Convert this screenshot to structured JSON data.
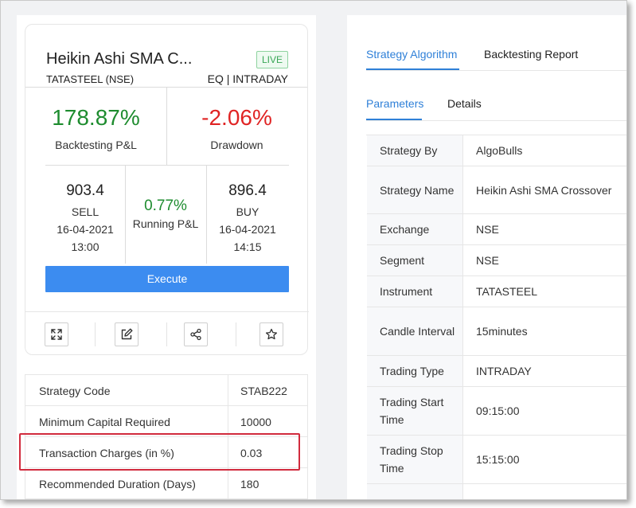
{
  "strategy_card": {
    "title": "Heikin Ashi SMA C...",
    "status_badge": "LIVE",
    "instrument": "TATASTEEL (NSE)",
    "segment_type": "EQ | INTRADAY",
    "backtesting_pnl_value": "178.87%",
    "backtesting_pnl_label": "Backtesting P&L",
    "drawdown_value": "-2.06%",
    "drawdown_label": "Drawdown",
    "sell": {
      "price": "903.4",
      "side": "SELL",
      "date": "16-04-2021",
      "time": "13:00"
    },
    "running_pnl_value": "0.77%",
    "running_pnl_label": "Running P&L",
    "buy": {
      "price": "896.4",
      "side": "BUY",
      "date": "16-04-2021",
      "time": "14:15"
    },
    "execute_label": "Execute"
  },
  "icons": [
    "expand-icon",
    "edit-icon",
    "share-icon",
    "star-icon"
  ],
  "info_table": [
    {
      "key": "Strategy Code",
      "value": "STAB222"
    },
    {
      "key": "Minimum Capital Required",
      "value": "10000"
    },
    {
      "key": "Transaction Charges (in %)",
      "value": "0.03"
    },
    {
      "key": "Recommended Duration (Days)",
      "value": "180"
    }
  ],
  "tabs": {
    "main": [
      "Strategy Algorithm",
      "Backtesting Report"
    ],
    "sub": [
      "Parameters",
      "Details"
    ]
  },
  "parameters": [
    {
      "key": "Strategy By",
      "value": "AlgoBulls"
    },
    {
      "key": "Strategy Name",
      "value": "Heikin Ashi SMA Crossover"
    },
    {
      "key": "Exchange",
      "value": "NSE"
    },
    {
      "key": "Segment",
      "value": "NSE"
    },
    {
      "key": "Instrument",
      "value": "TATASTEEL"
    },
    {
      "key": "Candle Interval",
      "value": "15minutes"
    },
    {
      "key": "Trading Type",
      "value": "INTRADAY"
    },
    {
      "key": "Trading Start Time",
      "value": "09:15:00"
    },
    {
      "key": "Trading Stop Time",
      "value": "15:15:00"
    }
  ],
  "colors": {
    "accent": "#2f80d8",
    "execute": "#3c8cf0",
    "positive": "#1e8c2f",
    "negative": "#e02424",
    "live": "#3aa757",
    "highlight": "#d12b3d"
  }
}
